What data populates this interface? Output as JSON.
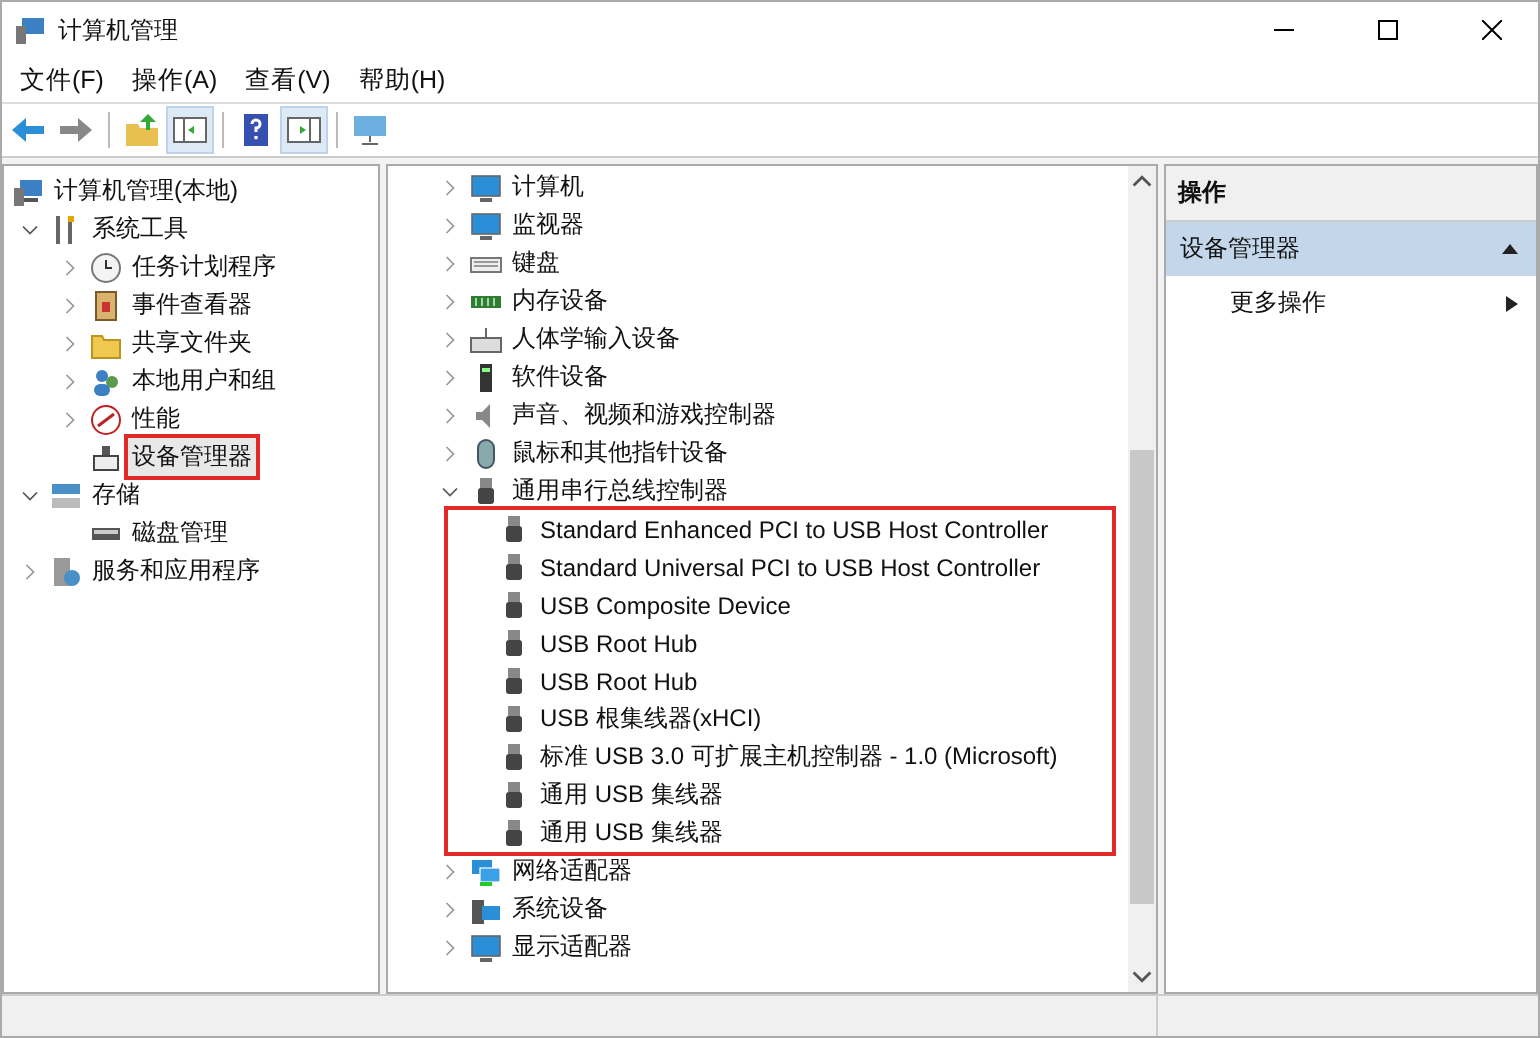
{
  "window": {
    "title": "计算机管理"
  },
  "menu": [
    "文件(F)",
    "操作(A)",
    "查看(V)",
    "帮助(H)"
  ],
  "toolbar": [
    {
      "kind": "back"
    },
    {
      "kind": "forward"
    },
    {
      "kind": "sep"
    },
    {
      "kind": "up"
    },
    {
      "kind": "tree"
    },
    {
      "kind": "sep"
    },
    {
      "kind": "help"
    },
    {
      "kind": "pane"
    },
    {
      "kind": "sep"
    },
    {
      "kind": "monitor"
    }
  ],
  "left_tree": [
    {
      "label": "计算机管理(本地)",
      "kind": "computer",
      "children": [
        {
          "label": "系统工具",
          "kind": "tools",
          "expanded": true,
          "children": [
            {
              "label": "任务计划程序",
              "kind": "clock",
              "expanded": false
            },
            {
              "label": "事件查看器",
              "kind": "log",
              "expanded": false
            },
            {
              "label": "共享文件夹",
              "kind": "folder",
              "expanded": false
            },
            {
              "label": "本地用户和组",
              "kind": "users",
              "expanded": false
            },
            {
              "label": "性能",
              "kind": "performance",
              "expanded": false
            },
            {
              "label": "设备管理器",
              "kind": "device",
              "highlighted": true
            }
          ]
        },
        {
          "label": "存储",
          "kind": "storage",
          "expanded": true,
          "children": [
            {
              "label": "磁盘管理",
              "kind": "disk"
            }
          ]
        },
        {
          "label": "服务和应用程序",
          "kind": "services",
          "expanded": false
        }
      ]
    }
  ],
  "device_tree": [
    {
      "label": "计算机",
      "kind": "monitor",
      "expanded": false
    },
    {
      "label": "监视器",
      "kind": "monitor",
      "expanded": false
    },
    {
      "label": "键盘",
      "kind": "keyboard",
      "expanded": false
    },
    {
      "label": "内存设备",
      "kind": "memory",
      "expanded": false
    },
    {
      "label": "人体学输入设备",
      "kind": "hid",
      "expanded": false
    },
    {
      "label": "软件设备",
      "kind": "software",
      "expanded": false
    },
    {
      "label": "声音、视频和游戏控制器",
      "kind": "sound",
      "expanded": false
    },
    {
      "label": "鼠标和其他指针设备",
      "kind": "mouse",
      "expanded": false
    },
    {
      "label": "通用串行总线控制器",
      "kind": "usb",
      "expanded": true,
      "children_highlighted": true,
      "children": [
        {
          "label": "Standard Enhanced PCI to USB Host Controller",
          "kind": "usb"
        },
        {
          "label": "Standard Universal PCI to USB Host Controller",
          "kind": "usb"
        },
        {
          "label": "USB Composite Device",
          "kind": "usb"
        },
        {
          "label": "USB Root Hub",
          "kind": "usb"
        },
        {
          "label": "USB Root Hub",
          "kind": "usb"
        },
        {
          "label": "USB 根集线器(xHCI)",
          "kind": "usb"
        },
        {
          "label": "标准 USB 3.0 可扩展主机控制器 - 1.0 (Microsoft)",
          "kind": "usb"
        },
        {
          "label": "通用 USB 集线器",
          "kind": "usb"
        },
        {
          "label": "通用 USB 集线器",
          "kind": "usb"
        }
      ]
    },
    {
      "label": "网络适配器",
      "kind": "network",
      "expanded": false
    },
    {
      "label": "系统设备",
      "kind": "system",
      "expanded": false
    },
    {
      "label": "显示适配器",
      "kind": "monitor",
      "expanded": false
    }
  ],
  "actions": {
    "title": "操作",
    "section": {
      "label": "设备管理器",
      "expanded": true
    },
    "items": [
      "更多操作"
    ]
  }
}
